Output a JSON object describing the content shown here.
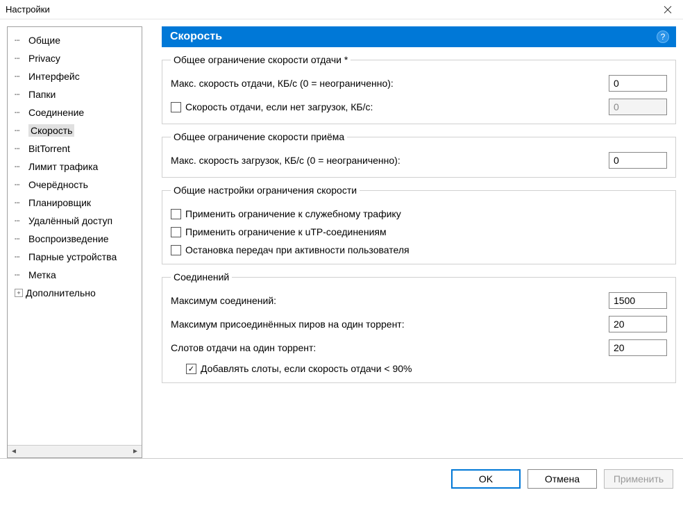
{
  "window": {
    "title": "Настройки"
  },
  "tree": {
    "items": [
      {
        "label": "Общие"
      },
      {
        "label": "Privacy"
      },
      {
        "label": "Интерфейс"
      },
      {
        "label": "Папки"
      },
      {
        "label": "Соединение"
      },
      {
        "label": "Скорость",
        "selected": true
      },
      {
        "label": "BitTorrent"
      },
      {
        "label": "Лимит трафика"
      },
      {
        "label": "Очерёдность"
      },
      {
        "label": "Планировщик"
      },
      {
        "label": "Удалённый доступ"
      },
      {
        "label": "Воспроизведение"
      },
      {
        "label": "Парные устройства"
      },
      {
        "label": "Метка"
      },
      {
        "label": "Дополнительно",
        "expander": "+"
      }
    ]
  },
  "main": {
    "header": "Скорость",
    "groups": {
      "upload": {
        "legend": "Общее ограничение скорости отдачи *",
        "max_upload_label": "Макс. скорость отдачи, КБ/с (0 = неограниченно):",
        "max_upload_value": "0",
        "idle_upload_check": "Скорость отдачи, если нет загрузок, КБ/с:",
        "idle_upload_value": "0"
      },
      "download": {
        "legend": "Общее ограничение скорости приёма",
        "max_download_label": "Макс. скорость загрузок, КБ/с (0 = неограниченно):",
        "max_download_value": "0"
      },
      "rate": {
        "legend": "Общие настройки ограничения скорости",
        "overhead_check": "Применить ограничение к служебному трафику",
        "utp_check": "Применить ограничение к uTP-соединениям",
        "user_activity_check": "Остановка передач при активности пользователя"
      },
      "conns": {
        "legend": "Соединений",
        "max_conn_label": "Максимум соединений:",
        "max_conn_value": "1500",
        "max_peers_label": "Максимум присоединённых пиров на один торрент:",
        "max_peers_value": "20",
        "upload_slots_label": "Слотов отдачи на один торрент:",
        "upload_slots_value": "20",
        "add_slots_check": "Добавлять слоты, если скорость отдачи < 90%"
      }
    }
  },
  "buttons": {
    "ok": "OK",
    "cancel": "Отмена",
    "apply": "Применить"
  }
}
